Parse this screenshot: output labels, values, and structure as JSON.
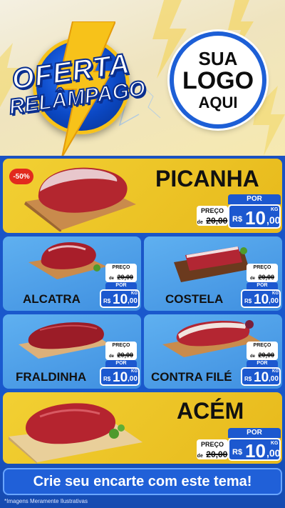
{
  "header": {
    "title_line1": "OFERTA",
    "title_line2": "RELÂMPAGO",
    "logo_line1": "SUA",
    "logo_line2": "LOGO",
    "logo_line3": "AQUI"
  },
  "colors": {
    "gold": "#f2d033",
    "blue": "#1c58cf",
    "card_blue": "#4a9ae6",
    "red": "#e22a1e"
  },
  "labels": {
    "preco": "PREÇO",
    "por": "POR",
    "de": "de",
    "currency": "R$",
    "unit": "KG"
  },
  "products": [
    {
      "name": "PICANHA",
      "discount": "-50%",
      "old_price": "20,00",
      "price_int": "10",
      "price_cents": ",00"
    },
    {
      "name": "ALCATRA",
      "old_price": "20,00",
      "price_int": "10",
      "price_cents": ",00"
    },
    {
      "name": "COSTELA",
      "old_price": "20,00",
      "price_int": "10",
      "price_cents": ",00"
    },
    {
      "name": "FRALDINHA",
      "old_price": "20,00",
      "price_int": "10",
      "price_cents": ",00"
    },
    {
      "name": "CONTRA FILÉ",
      "old_price": "20,00",
      "price_int": "10",
      "price_cents": ",00"
    },
    {
      "name": "ACÉM",
      "old_price": "20,00",
      "price_int": "10",
      "price_cents": ",00"
    }
  ],
  "cta": "Crie seu encarte com este tema!",
  "note": "*Imagens Meramente Ilustrativas"
}
